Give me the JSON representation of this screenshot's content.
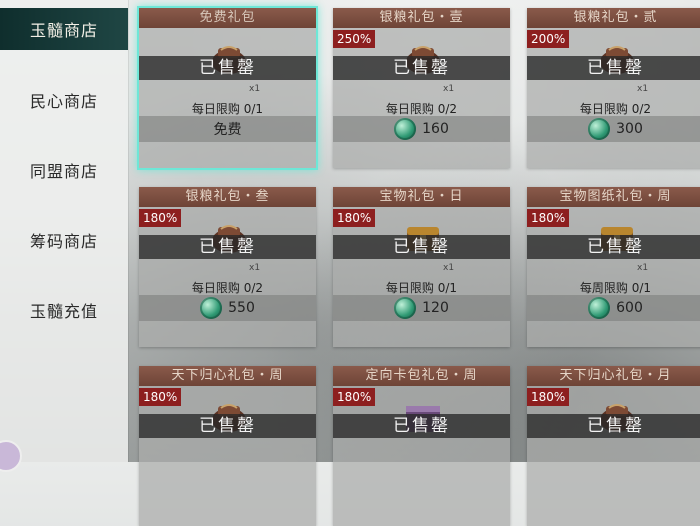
{
  "sidebar": {
    "items": [
      {
        "label": "玉髓商店",
        "active": true
      },
      {
        "label": "民心商店",
        "active": false
      },
      {
        "label": "同盟商店",
        "active": false
      },
      {
        "label": "筹码商店",
        "active": false
      },
      {
        "label": "玉髓充值",
        "active": false
      }
    ]
  },
  "cards": [
    {
      "title": "免费礼包",
      "badge": "",
      "sold": "已售罄",
      "qty": "x1",
      "limit": "每日限购 0/1",
      "price": "免费",
      "currency": "",
      "selected": true,
      "icon": "pouch-icon"
    },
    {
      "title": "银粮礼包・壹",
      "badge": "250%",
      "sold": "已售罄",
      "qty": "x1",
      "limit": "每日限购 0/2",
      "price": "160",
      "currency": "jade-icon",
      "selected": false,
      "icon": "pouch-icon"
    },
    {
      "title": "银粮礼包・贰",
      "badge": "200%",
      "sold": "已售罄",
      "qty": "x1",
      "limit": "每日限购 0/2",
      "price": "300",
      "currency": "jade-icon",
      "selected": false,
      "icon": "pouch-icon"
    },
    {
      "title": "银粮礼包・叁",
      "badge": "180%",
      "sold": "已售罄",
      "qty": "x1",
      "limit": "每日限购 0/2",
      "price": "550",
      "currency": "jade-icon",
      "selected": false,
      "icon": "pouch-icon"
    },
    {
      "title": "宝物礼包・日",
      "badge": "180%",
      "sold": "已售罄",
      "qty": "x1",
      "limit": "每日限购 0/1",
      "price": "120",
      "currency": "jade-icon",
      "selected": false,
      "icon": "chest-icon"
    },
    {
      "title": "宝物图纸礼包・周",
      "badge": "180%",
      "sold": "已售罄",
      "qty": "x1",
      "limit": "每周限购 0/1",
      "price": "600",
      "currency": "jade-icon",
      "selected": false,
      "icon": "chest-icon"
    },
    {
      "title": "天下归心礼包・周",
      "badge": "180%",
      "sold": "已售罄",
      "qty": "",
      "limit": "",
      "price": "",
      "currency": "",
      "selected": false,
      "icon": "pouch-icon"
    },
    {
      "title": "定向卡包礼包・周",
      "badge": "180%",
      "sold": "已售罄",
      "qty": "",
      "limit": "",
      "price": "",
      "currency": "",
      "selected": false,
      "icon": "box-icon"
    },
    {
      "title": "天下归心礼包・月",
      "badge": "180%",
      "sold": "已售罄",
      "qty": "",
      "limit": "",
      "price": "",
      "currency": "",
      "selected": false,
      "icon": "pouch-icon"
    }
  ],
  "colors": {
    "accent": "#6ee7d7",
    "title_bar": "#7a4b3d",
    "badge": "#8d1f1f",
    "sidebar_active": "#153836"
  }
}
